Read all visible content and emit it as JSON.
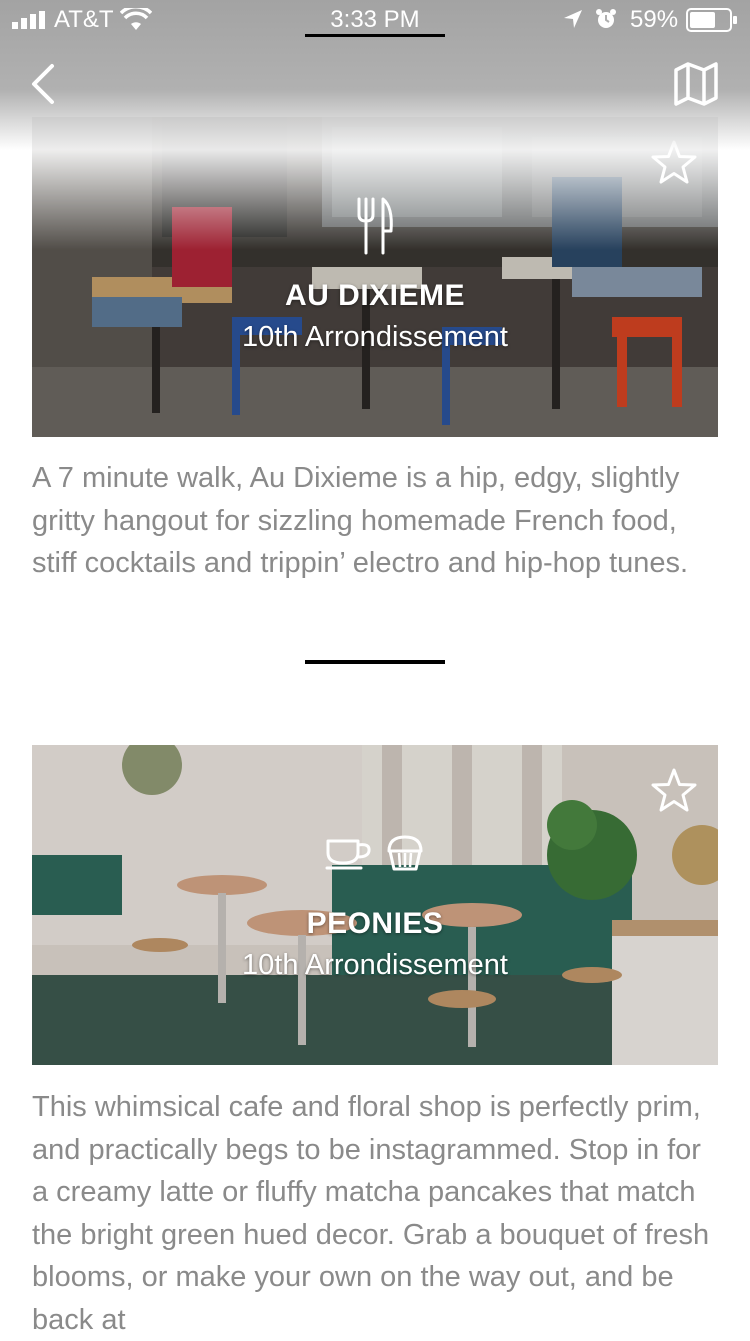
{
  "status_bar": {
    "carrier": "AT&T",
    "time": "3:33 PM",
    "battery_percent": "59%"
  },
  "nav": {
    "back_icon": "chevron-left-icon",
    "map_icon": "map-icon"
  },
  "places": [
    {
      "name": "AU DIXIEME",
      "area": "10th Arrondissement",
      "category_icons": [
        "fork-knife-icon"
      ],
      "favorite_icon": "star-outline-icon",
      "description": "A 7 minute walk, Au Dixieme is a hip, edgy, slightly gritty hangout for sizzling homemade French food, stiff cocktails and trippin’ electro and hip-hop tunes."
    },
    {
      "name": "PEONIES",
      "area": "10th Arrondissement",
      "category_icons": [
        "coffee-cup-icon",
        "cupcake-icon"
      ],
      "favorite_icon": "star-outline-icon",
      "description": "This whimsical cafe and floral shop is perfectly prim, and practically begs to be instagrammed. Stop in for a creamy latte or fluffy matcha pancakes that match the bright green hued decor. Grab a bouquet of fresh blooms, or make your own on the way out, and be back at"
    }
  ],
  "colors": {
    "description_text": "#8a8a8a",
    "overlay_text": "#ffffff",
    "divider": "#000000"
  }
}
